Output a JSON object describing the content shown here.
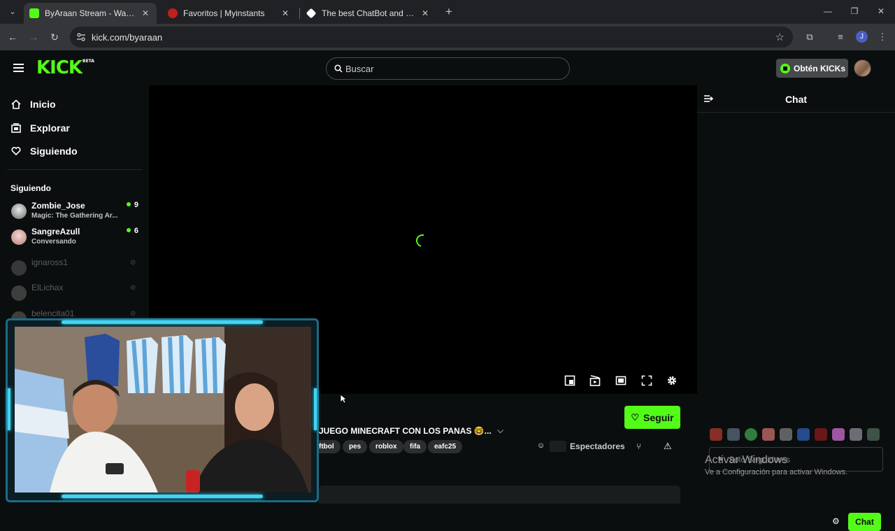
{
  "browser": {
    "tabs": [
      {
        "title": "ByAraan Stream - Watch Live on Kick",
        "favicon_color": "#53fc18",
        "active": true
      },
      {
        "title": "Favoritos | Myinstants",
        "favicon_color": "#c0201a",
        "active": false
      },
      {
        "title": "The best ChatBot and Widgets for your Stream",
        "favicon_color": "#ffffff",
        "active": false
      }
    ],
    "url": "kick.com/byaraan",
    "profile_initial": "J"
  },
  "kick": {
    "logo": "KICK",
    "logo_badge": "BETA",
    "search_placeholder": "Buscar",
    "get_kicks_label": "Obtén KICKs",
    "nav": [
      {
        "label": "Inicio",
        "icon": "home-icon"
      },
      {
        "label": "Explorar",
        "icon": "explore-icon"
      },
      {
        "label": "Siguiendo",
        "icon": "heart-icon"
      }
    ],
    "following_heading": "Siguiendo",
    "following": [
      {
        "name": "Zombie_Jose",
        "category": "Magic: The Gathering Ar...",
        "viewers": "9",
        "live": true
      },
      {
        "name": "SangreAzull",
        "category": "Conversando",
        "viewers": "6",
        "live": true
      },
      {
        "name": "ignaross1",
        "live": false
      },
      {
        "name": "ElLichax",
        "live": false
      },
      {
        "name": "belencita01",
        "live": false
      }
    ],
    "stream": {
      "title": "JUEGO MINECRAFT CON LOS PANAS 🤓...",
      "tags": [
        "ftbol",
        "pes",
        "roblox",
        "fifa",
        "eafc25"
      ],
      "follow_label": "Seguir",
      "viewers_label": "Espectadores"
    },
    "chat": {
      "title": "Chat",
      "input_placeholder": "Solo Seguidores",
      "send_label": "Chat"
    }
  },
  "windows_watermark": {
    "line1": "Activar Windows",
    "line2": "Ve a Configuración para activar Windows."
  },
  "colors": {
    "kick_green": "#53fc18",
    "background": "#0b0e0f",
    "webcam_frame": "#3fd5f2"
  }
}
